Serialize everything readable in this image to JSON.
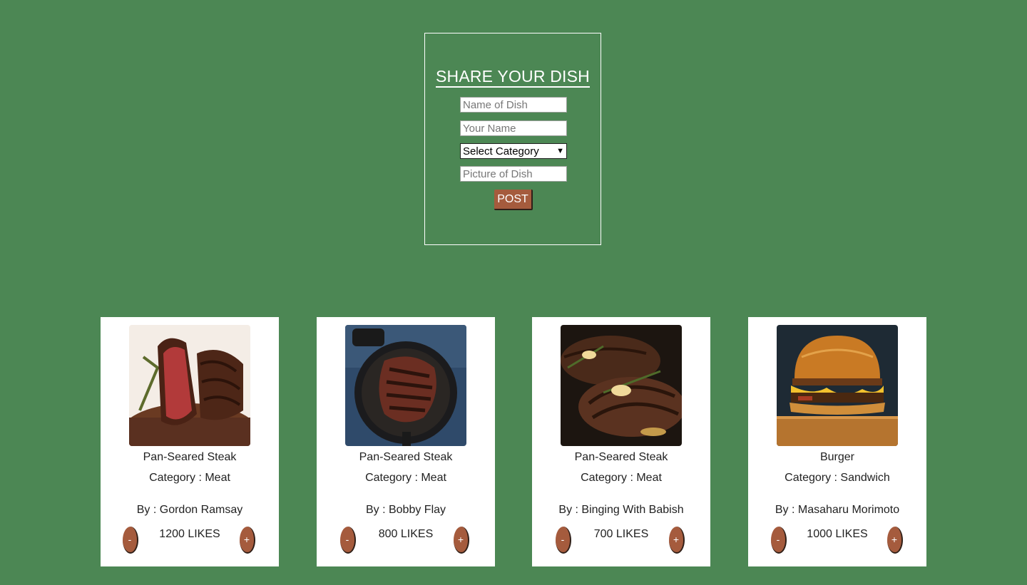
{
  "form": {
    "title": "SHARE YOUR DISH",
    "dish_placeholder": "Name of Dish",
    "name_placeholder": "Your Name",
    "category_selected": "Select Category",
    "picture_placeholder": "Picture of Dish",
    "post_label": "POST"
  },
  "cards": [
    {
      "dish": "Pan-Seared Steak",
      "category": "Category : Meat",
      "by": "By : Gordon Ramsay",
      "likes": "1200 LIKES",
      "minus": "-",
      "plus": "+",
      "image_icon": "sliced-steak-photo"
    },
    {
      "dish": "Pan-Seared Steak",
      "category": "Category : Meat",
      "by": "By : Bobby Flay",
      "likes": "800 LIKES",
      "minus": "-",
      "plus": "+",
      "image_icon": "steak-in-skillet-photo"
    },
    {
      "dish": "Pan-Seared Steak",
      "category": "Category : Meat",
      "by": "By : Binging With Babish",
      "likes": "700 LIKES",
      "minus": "-",
      "plus": "+",
      "image_icon": "steaks-with-rosemary-photo"
    },
    {
      "dish": "Burger",
      "category": "Category : Sandwich",
      "by": "By : Masaharu Morimoto",
      "likes": "1000 LIKES",
      "minus": "-",
      "plus": "+",
      "image_icon": "burger-photo"
    }
  ],
  "colors": {
    "background": "#4c8754",
    "button": "#a55b3d",
    "card": "#ffffff"
  }
}
